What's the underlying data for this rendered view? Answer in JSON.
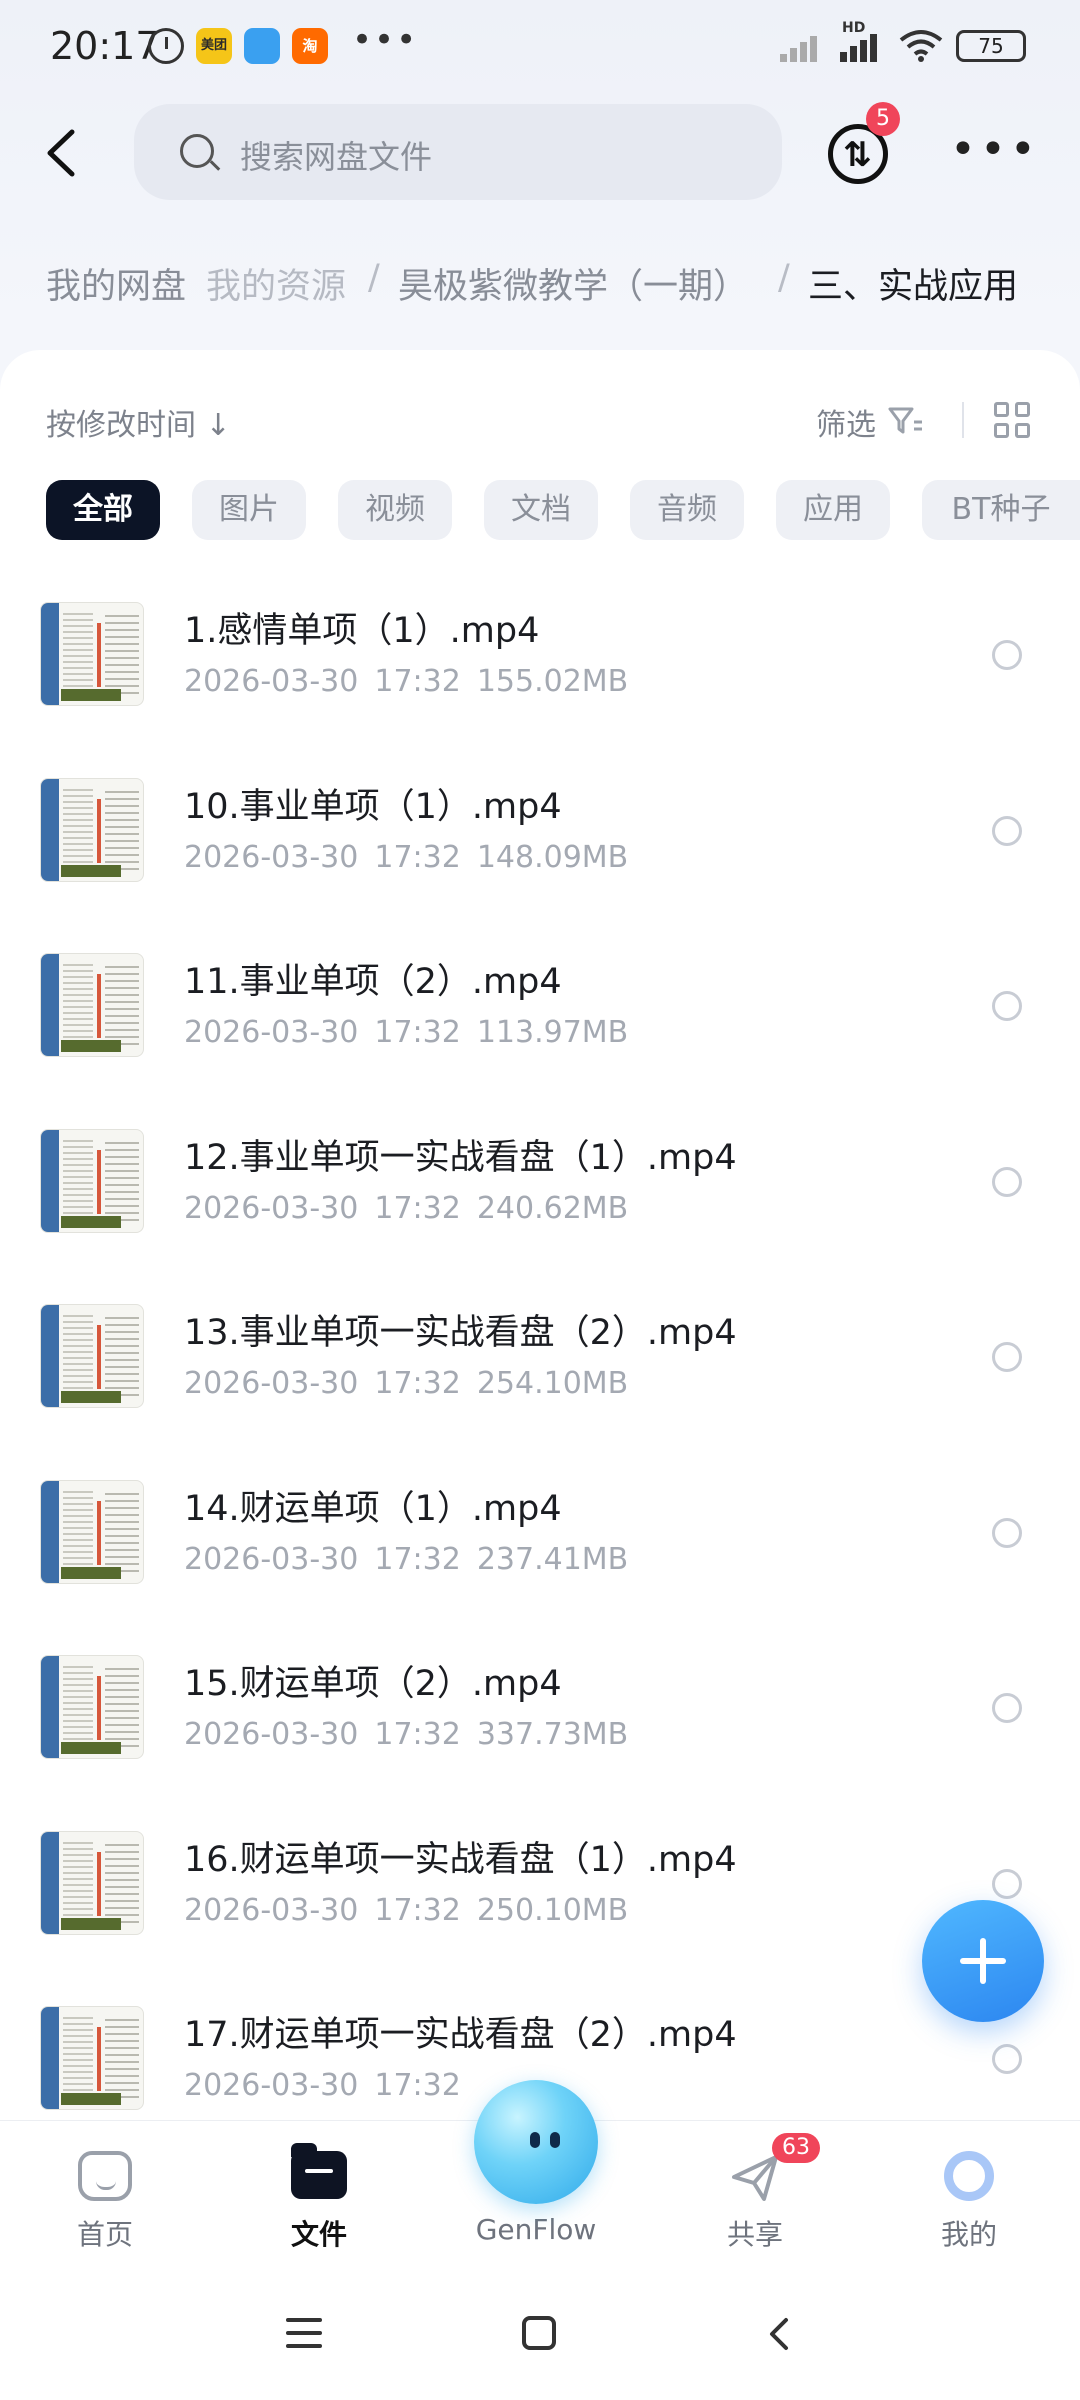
{
  "status_bar": {
    "time": "20:17",
    "app_icons": [
      {
        "name": "meituan-icon",
        "label": "美团",
        "color": "#f5c518"
      },
      {
        "name": "app-blue-icon",
        "label": "",
        "color": "#3aa0f0"
      },
      {
        "name": "taobao-icon",
        "label": "淘",
        "color": "#ff6a00"
      }
    ],
    "more_dots": "•••",
    "network_label": "HD",
    "battery": "75"
  },
  "header": {
    "search_placeholder": "搜索网盘文件",
    "transfer_badge": "5"
  },
  "breadcrumb": {
    "items": [
      "我的网盘",
      "我的资源",
      "昊极紫微教学（一期）",
      "三、实战应用"
    ],
    "separator": "/"
  },
  "toolbar": {
    "sort_label": "按修改时间 ↓",
    "filter_label": "筛选"
  },
  "chips": [
    {
      "label": "全部",
      "active": true
    },
    {
      "label": "图片"
    },
    {
      "label": "视频"
    },
    {
      "label": "文档"
    },
    {
      "label": "音频"
    },
    {
      "label": "应用"
    },
    {
      "label": "BT种子"
    }
  ],
  "files": [
    {
      "name": "1.感情单项（1）.mp4",
      "date": "2026-03-30",
      "time": "17:32",
      "size": "155.02MB"
    },
    {
      "name": "10.事业单项（1）.mp4",
      "date": "2026-03-30",
      "time": "17:32",
      "size": "148.09MB"
    },
    {
      "name": "11.事业单项（2）.mp4",
      "date": "2026-03-30",
      "time": "17:32",
      "size": "113.97MB"
    },
    {
      "name": "12.事业单项一实战看盘（1）.mp4",
      "date": "2026-03-30",
      "time": "17:32",
      "size": "240.62MB"
    },
    {
      "name": "13.事业单项一实战看盘（2）.mp4",
      "date": "2026-03-30",
      "time": "17:32",
      "size": "254.10MB"
    },
    {
      "name": "14.财运单项（1）.mp4",
      "date": "2026-03-30",
      "time": "17:32",
      "size": "237.41MB"
    },
    {
      "name": "15.财运单项（2）.mp4",
      "date": "2026-03-30",
      "time": "17:32",
      "size": "337.73MB"
    },
    {
      "name": "16.财运单项一实战看盘（1）.mp4",
      "date": "2026-03-30",
      "time": "17:32",
      "size": "250.10MB"
    },
    {
      "name": "17.财运单项一实战看盘（2）.mp4",
      "date": "2026-03-30",
      "time": "17:32",
      "size": ""
    }
  ],
  "bottom_nav": [
    {
      "label": "首页"
    },
    {
      "label": "文件",
      "active": true
    },
    {
      "label": "GenFlow"
    },
    {
      "label": "共享",
      "badge": "63"
    },
    {
      "label": "我的"
    }
  ],
  "colors": {
    "accent": "#2c86f0",
    "badge_red": "#f0455a",
    "chip_active": "#0c1426"
  }
}
